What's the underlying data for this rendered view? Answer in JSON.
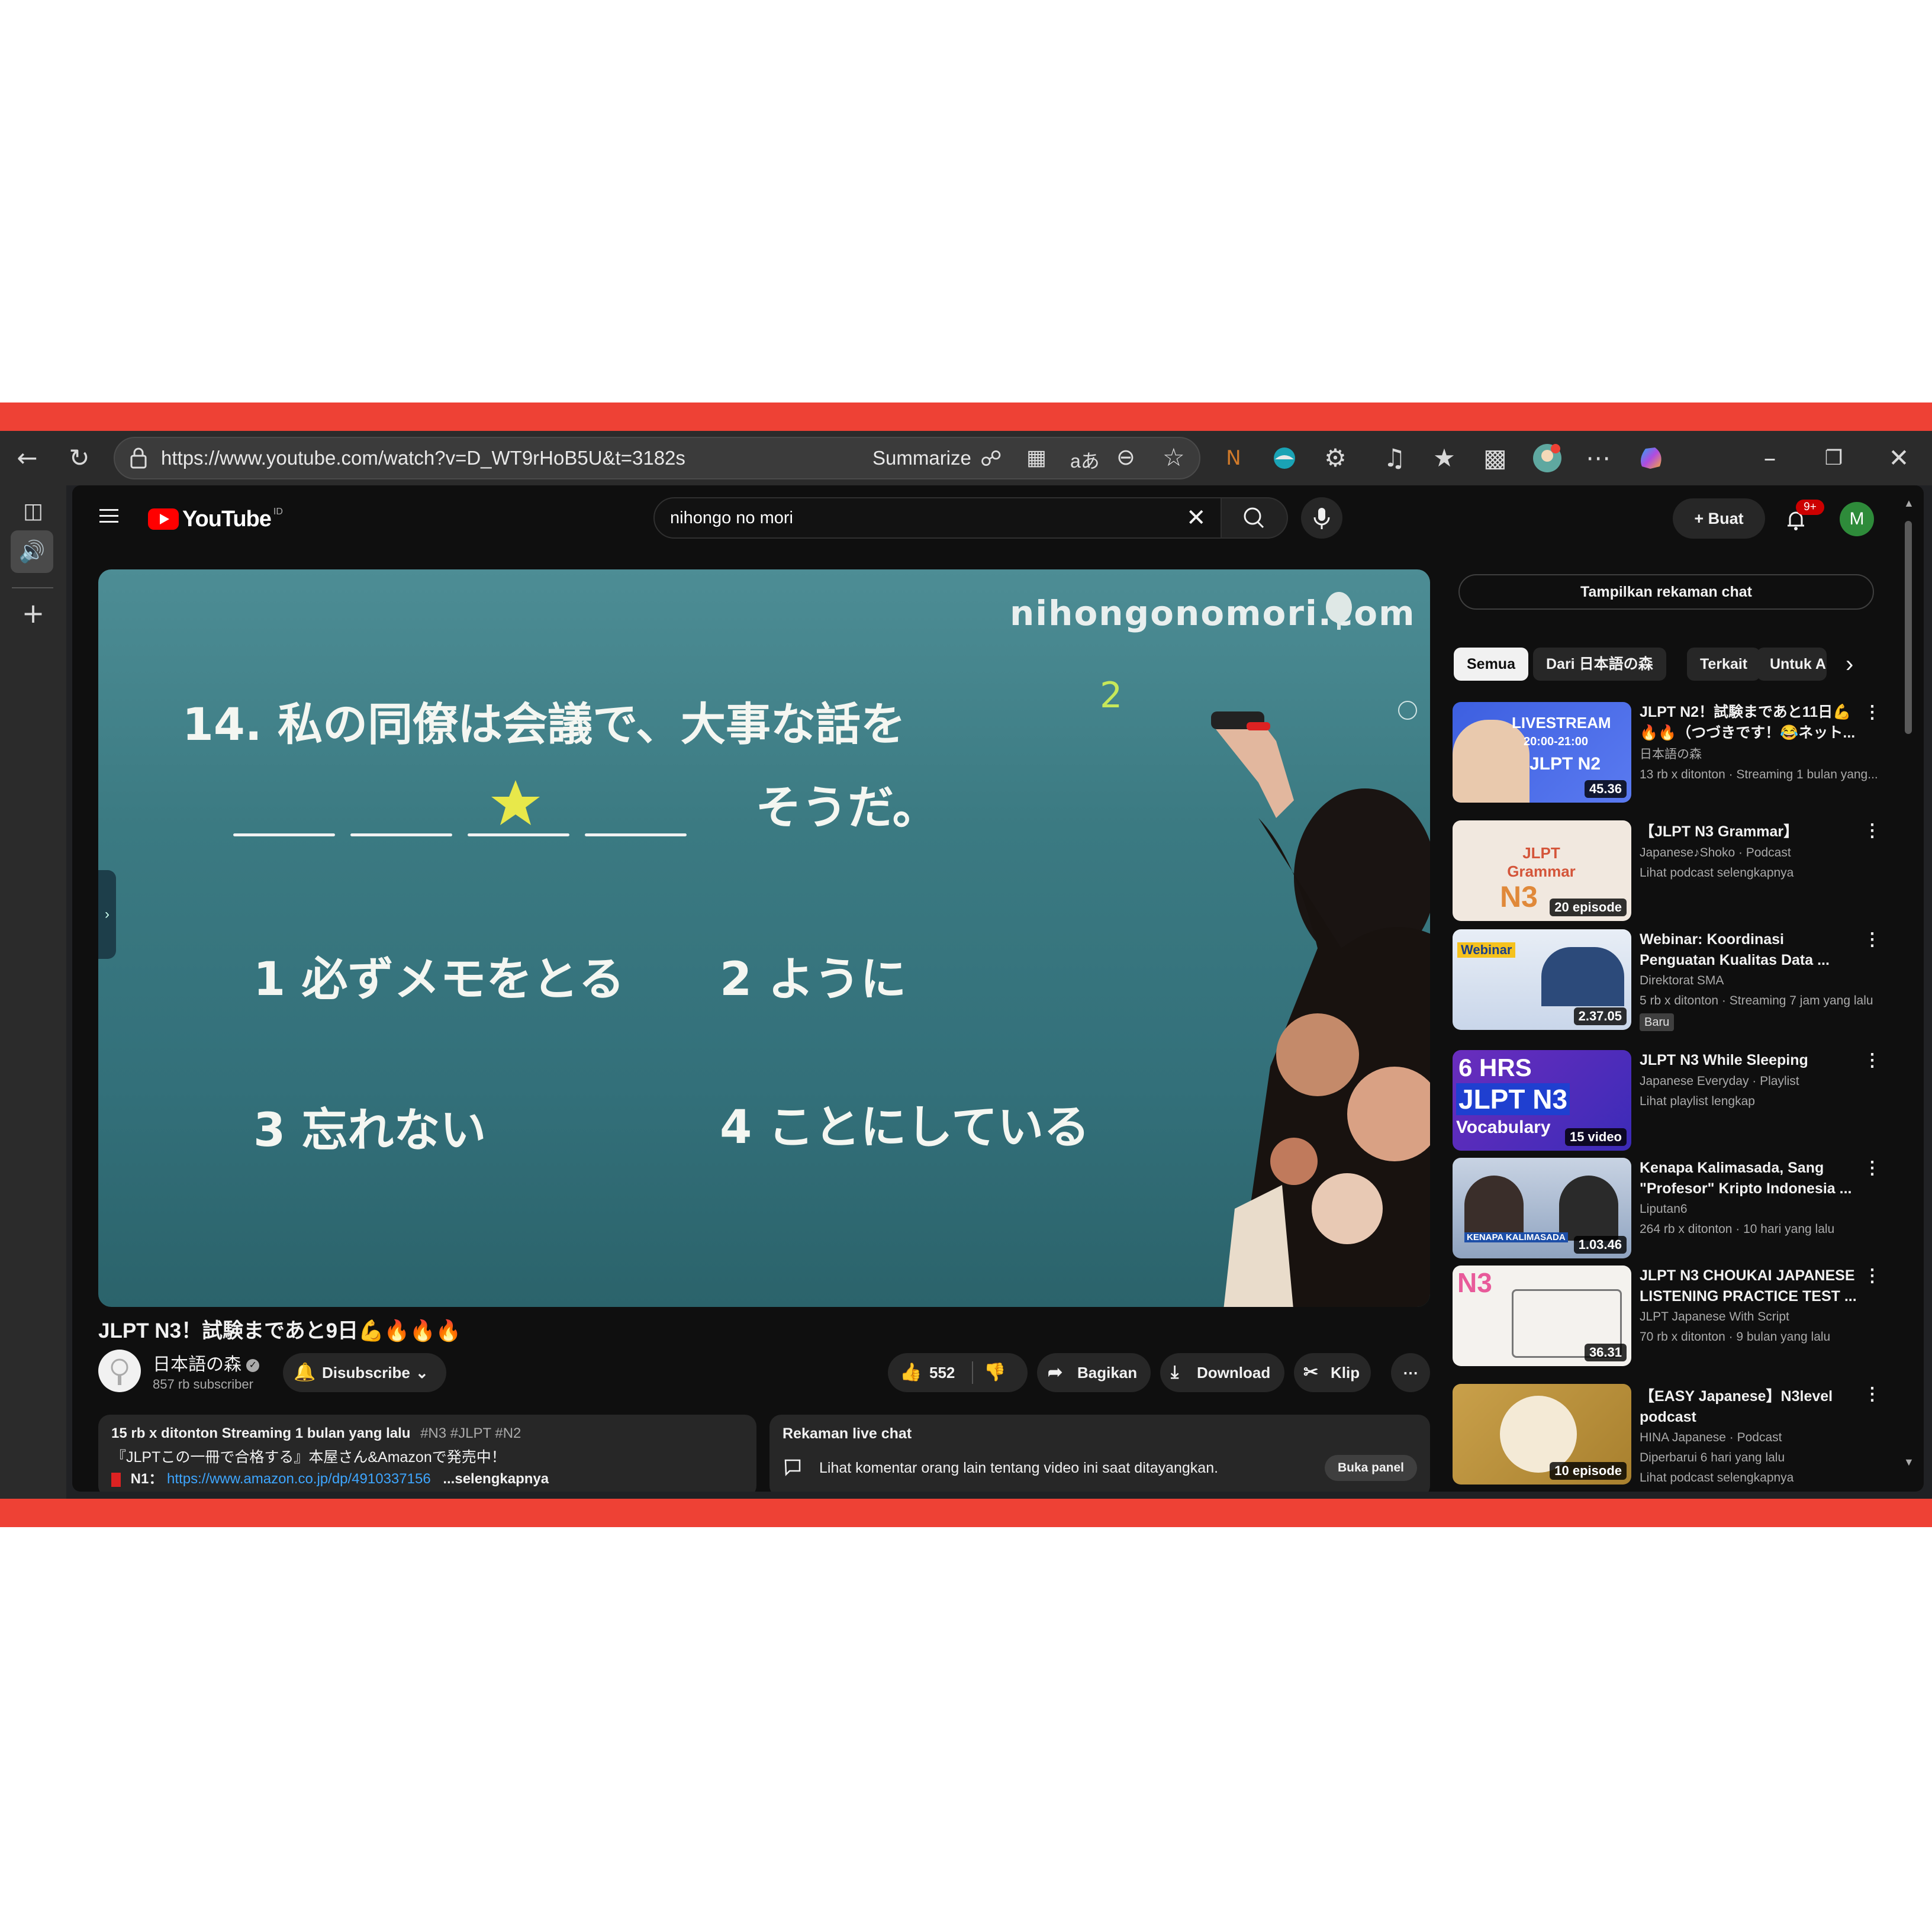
{
  "browser": {
    "url": "https://www.youtube.com/watch?v=D_WT9rHoB5U&t=3182s",
    "summarize_label": "Summarize"
  },
  "youtube": {
    "logo_text": "YouTube",
    "logo_region": "ID",
    "search_value": "nihongo no mori",
    "create_label": "Buat",
    "notif_badge": "9+",
    "avatar_letter": "M"
  },
  "video": {
    "watermark": "nihongonomori.com",
    "board_line1": "14. 私の同僚は会議で、大事な話を",
    "board_line2": "そうだ。",
    "board_mark": "2",
    "option1": "1 必ずメモをとる",
    "option2": "2 ように",
    "option3": "3 忘れない",
    "option4": "4 ことにしている",
    "title": "JLPT N3！試験まであと9日💪🔥🔥🔥",
    "channel": "日本語の森",
    "subscribers": "857 rb subscriber",
    "subscribe_label": "Disubscribe",
    "likes": "552",
    "share_label": "Bagikan",
    "download_label": "Download",
    "clip_label": "Klip"
  },
  "description": {
    "meta": "15 rb x ditonton  Streaming 1 bulan yang lalu",
    "tags": "#N3 #JLPT #N2",
    "line2": "『JLPTこの一冊で合格する』本屋さん&Amazonで発売中！",
    "line3_label": "N1：",
    "link": "https://www.amazon.co.jp/dp/4910337156",
    "more": "...selengkapnya"
  },
  "livechat": {
    "title": "Rekaman live chat",
    "text": "Lihat komentar orang lain tentang video ini saat ditayangkan.",
    "button": "Buka panel"
  },
  "sidebar": {
    "show_chat": "Tampilkan rekaman chat",
    "chips": [
      "Semua",
      "Dari 日本語の森",
      "Terkait",
      "Untuk A"
    ],
    "items": [
      {
        "title": "JLPT N2！試験まであと11日💪🔥🔥（つづきです！😂ネット...",
        "channel": "日本語の森",
        "meta": "13 rb x ditonton · Streaming 1 bulan yang...",
        "duration": "45.36",
        "thumb_text": "LIVESTREAM",
        "thumb_sub": "20:00-21:00",
        "thumb_big": "JLPT N2"
      },
      {
        "title": "【JLPT N3 Grammar】",
        "channel": "Japanese♪Shoko · Podcast",
        "meta": "Lihat podcast selengkapnya",
        "duration": "20 episode",
        "thumb_text": "JLPT Grammar",
        "thumb_big": "N3"
      },
      {
        "title": "Webinar: Koordinasi Penguatan Kualitas Data ...",
        "channel": "Direktorat SMA",
        "meta": "5 rb x ditonton · Streaming 7 jam yang lalu",
        "badge": "Baru",
        "duration": "2.37.05",
        "thumb_text": "Webinar"
      },
      {
        "title": "JLPT N3 While Sleeping",
        "channel": "Japanese Everyday · Playlist",
        "meta": "Lihat playlist lengkap",
        "duration": "15 video",
        "thumb_text": "6 HRS",
        "thumb_big": "JLPT N3",
        "thumb_sub": "Vocabulary"
      },
      {
        "title": "Kenapa Kalimasada, Sang \"Profesor\" Kripto Indonesia ...",
        "channel": "Liputan6",
        "meta": "264 rb x ditonton · 10 hari yang lalu",
        "duration": "1.03.46",
        "thumb_text": "KENAPA KALIMASADA"
      },
      {
        "title": "JLPT N3 CHOUKAI JAPANESE LISTENING PRACTICE TEST ...",
        "channel": "JLPT Japanese With Script",
        "meta": "70 rb x ditonton · 9 bulan yang lalu",
        "duration": "36.31",
        "thumb_text": "N3"
      },
      {
        "title": "【EASY Japanese】N3level podcast",
        "channel": "HINA Japanese · Podcast",
        "meta": "Diperbarui 6 hari yang lalu",
        "meta2": "Lihat podcast selengkapnya",
        "duration": "10 episode"
      }
    ]
  },
  "colors": {
    "frame_red": "#ee4135",
    "yt_red": "#ff0000",
    "page_bg": "#0f0f0f",
    "board": "#3b7a82",
    "star": "#e8e84a",
    "link": "#3ea6ff"
  }
}
